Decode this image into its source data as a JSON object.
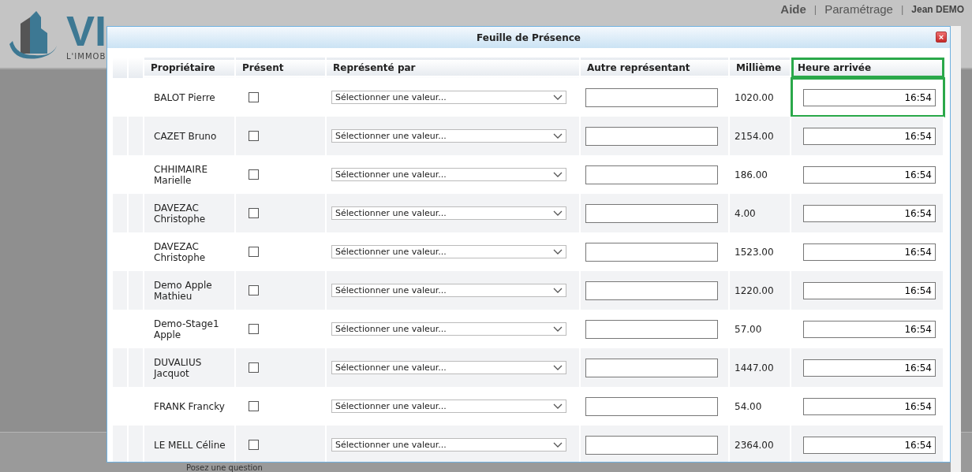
{
  "header": {
    "logo_text": "VI",
    "logo_subtext": "L'IMMOB",
    "links": [
      {
        "label": "Aide",
        "bold": true,
        "separator": "|"
      },
      {
        "label": "Paramétrage",
        "bold": false,
        "separator": "|"
      }
    ],
    "user": "Jean DEMO"
  },
  "footer": {
    "help_text": "Posez une question"
  },
  "dialog": {
    "title": "Feuille de Présence",
    "close": "×",
    "table": {
      "columns": [
        {
          "label": "Propriétaire",
          "highlighted": false
        },
        {
          "label": "Présent",
          "highlighted": false
        },
        {
          "label": "Représenté par",
          "highlighted": false
        },
        {
          "label": "Autre représentant",
          "highlighted": false
        },
        {
          "label": "Millième",
          "highlighted": false
        },
        {
          "label": "Heure arrivée",
          "highlighted": true
        }
      ],
      "rows": [
        {
          "owner": "BALOT Pierre",
          "present": false,
          "represented_by": "Sélectionner une valeur...",
          "other": "",
          "millieme": "1020.00",
          "arrival": "16:54",
          "highlighted": true
        },
        {
          "owner": "CAZET Bruno",
          "present": false,
          "represented_by": "Sélectionner une valeur...",
          "other": "",
          "millieme": "2154.00",
          "arrival": "16:54",
          "highlighted": false
        },
        {
          "owner": "CHHIMAIRE Marielle",
          "present": false,
          "represented_by": "Sélectionner une valeur...",
          "other": "",
          "millieme": "186.00",
          "arrival": "16:54",
          "highlighted": false
        },
        {
          "owner": "DAVEZAC Christophe",
          "present": false,
          "represented_by": "Sélectionner une valeur...",
          "other": "",
          "millieme": "4.00",
          "arrival": "16:54",
          "highlighted": false
        },
        {
          "owner": "DAVEZAC Christophe",
          "present": false,
          "represented_by": "Sélectionner une valeur...",
          "other": "",
          "millieme": "1523.00",
          "arrival": "16:54",
          "highlighted": false
        },
        {
          "owner": "Demo Apple Mathieu",
          "present": false,
          "represented_by": "Sélectionner une valeur...",
          "other": "",
          "millieme": "1220.00",
          "arrival": "16:54",
          "highlighted": false
        },
        {
          "owner": "Demo-Stage1 Apple",
          "present": false,
          "represented_by": "Sélectionner une valeur...",
          "other": "",
          "millieme": "57.00",
          "arrival": "16:54",
          "highlighted": false
        },
        {
          "owner": "DUVALIUS Jacquot",
          "present": false,
          "represented_by": "Sélectionner une valeur...",
          "other": "",
          "millieme": "1447.00",
          "arrival": "16:54",
          "highlighted": false
        },
        {
          "owner": "FRANK Francky",
          "present": false,
          "represented_by": "Sélectionner une valeur...",
          "other": "",
          "millieme": "54.00",
          "arrival": "16:54",
          "highlighted": false
        },
        {
          "owner": "LE MELL Céline",
          "present": false,
          "represented_by": "Sélectionner une valeur...",
          "other": "",
          "millieme": "2364.00",
          "arrival": "16:54",
          "highlighted": false
        }
      ]
    }
  }
}
